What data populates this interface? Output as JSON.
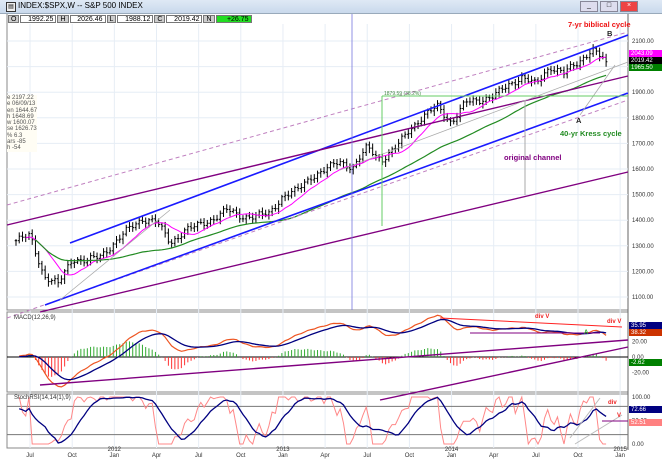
{
  "window": {
    "title": "INDEX:$SPX,W -- S&P 500 INDEX",
    "controls": [
      "_",
      "□",
      "×"
    ]
  },
  "ohlc": {
    "open": "1992.25",
    "high": "2026.46",
    "low": "1988.12",
    "close": "2019.42",
    "change": "+26.75"
  },
  "info_panel": [
    "e  2197.22",
    "e  06/09/13",
    "en  1644.67",
    "h  1648.69",
    "w  1600.07",
    "se  1626.73",
    "%  6.3",
    "ars  -85",
    "h  -54"
  ],
  "chart_data": [
    {
      "type": "line",
      "panel": "price",
      "title": "S&P 500 INDEX",
      "style": "weekly-ohlc-bars",
      "x_months": [
        "2011-06",
        "2011-07",
        "2011-08",
        "2011-09",
        "2011-10",
        "2011-11",
        "2011-12",
        "2012-01",
        "2012-02",
        "2012-03",
        "2012-04",
        "2012-05",
        "2012-06",
        "2012-07",
        "2012-08",
        "2012-09",
        "2012-10",
        "2012-11",
        "2012-12",
        "2013-01",
        "2013-02",
        "2013-03",
        "2013-04",
        "2013-05",
        "2013-06",
        "2013-07",
        "2013-08",
        "2013-09",
        "2013-10",
        "2013-11",
        "2013-12",
        "2014-01",
        "2014-02",
        "2014-03",
        "2014-04",
        "2014-05",
        "2014-06",
        "2014-07",
        "2014-08",
        "2014-09",
        "2014-10",
        "2014-11",
        "2014-12"
      ],
      "close_approx": [
        1320,
        1340,
        1180,
        1150,
        1250,
        1240,
        1260,
        1310,
        1365,
        1405,
        1395,
        1310,
        1360,
        1380,
        1405,
        1440,
        1415,
        1415,
        1425,
        1495,
        1515,
        1570,
        1595,
        1630,
        1605,
        1685,
        1635,
        1680,
        1755,
        1805,
        1845,
        1780,
        1860,
        1870,
        1885,
        1925,
        1960,
        1930,
        2000,
        1975,
        2015,
        2068,
        2019
      ],
      "ylim": [
        1050,
        2200
      ],
      "yticks": [
        "2200.00",
        "2100.00",
        "2000.00",
        "1900.00",
        "1800.00",
        "1700.00",
        "1600.00",
        "1500.00",
        "1400.00",
        "1300.00",
        "1200.00",
        "1100.00"
      ],
      "series_tags": [
        {
          "value": "2043.09",
          "color": "#ff00ff"
        },
        {
          "value": "2019.42",
          "color": "#000000"
        },
        {
          "value": "1965.50",
          "color": "#008000"
        }
      ],
      "annotations": {
        "cycle7": "7-yr biblical cycle",
        "b": "B",
        "a": "A",
        "kress": "40-yr Kress cycle",
        "channel": "original channel",
        "fib": "1879.59 (38.2%)"
      },
      "colors": {
        "ma_fast": "#ff00ff",
        "ma_slow": "#228b22",
        "channel": "#1a1aff",
        "purple": "#800080",
        "fib": "#66cc66"
      }
    },
    {
      "type": "line",
      "panel": "macd",
      "title": "MACD(12,26,9)",
      "yticks": [
        "40.00",
        "20.00",
        "0.00",
        "-20.00"
      ],
      "tags": [
        {
          "value": "38.32",
          "color": "#cc3300"
        },
        {
          "value": "35.95",
          "color": "#000080"
        },
        {
          "value": "-2.62",
          "color": "#008000"
        }
      ],
      "annotations": [
        "div V",
        "div V",
        "A"
      ]
    },
    {
      "type": "line",
      "panel": "stochrsi",
      "title": "StochRSI(14,14(1),9)",
      "yticks": [
        "100.00",
        "50.00",
        "0.00"
      ],
      "tags": [
        {
          "value": "72.66",
          "color": "#000080"
        },
        {
          "value": "52.51",
          "color": "#ff8080"
        }
      ],
      "annotations": [
        "div",
        "V"
      ]
    },
    {
      "xticks": [
        {
          "m": "Jul",
          "y": ""
        },
        {
          "m": "Oct",
          "y": ""
        },
        {
          "m": "Jan",
          "y": "2012"
        },
        {
          "m": "Apr",
          "y": ""
        },
        {
          "m": "Jul",
          "y": ""
        },
        {
          "m": "Oct",
          "y": ""
        },
        {
          "m": "Jan",
          "y": "2013"
        },
        {
          "m": "Apr",
          "y": ""
        },
        {
          "m": "Jul",
          "y": ""
        },
        {
          "m": "Oct",
          "y": ""
        },
        {
          "m": "Jan",
          "y": "2014"
        },
        {
          "m": "Apr",
          "y": ""
        },
        {
          "m": "Jul",
          "y": ""
        },
        {
          "m": "Oct",
          "y": ""
        },
        {
          "m": "Jan",
          "y": "2015"
        }
      ]
    }
  ]
}
